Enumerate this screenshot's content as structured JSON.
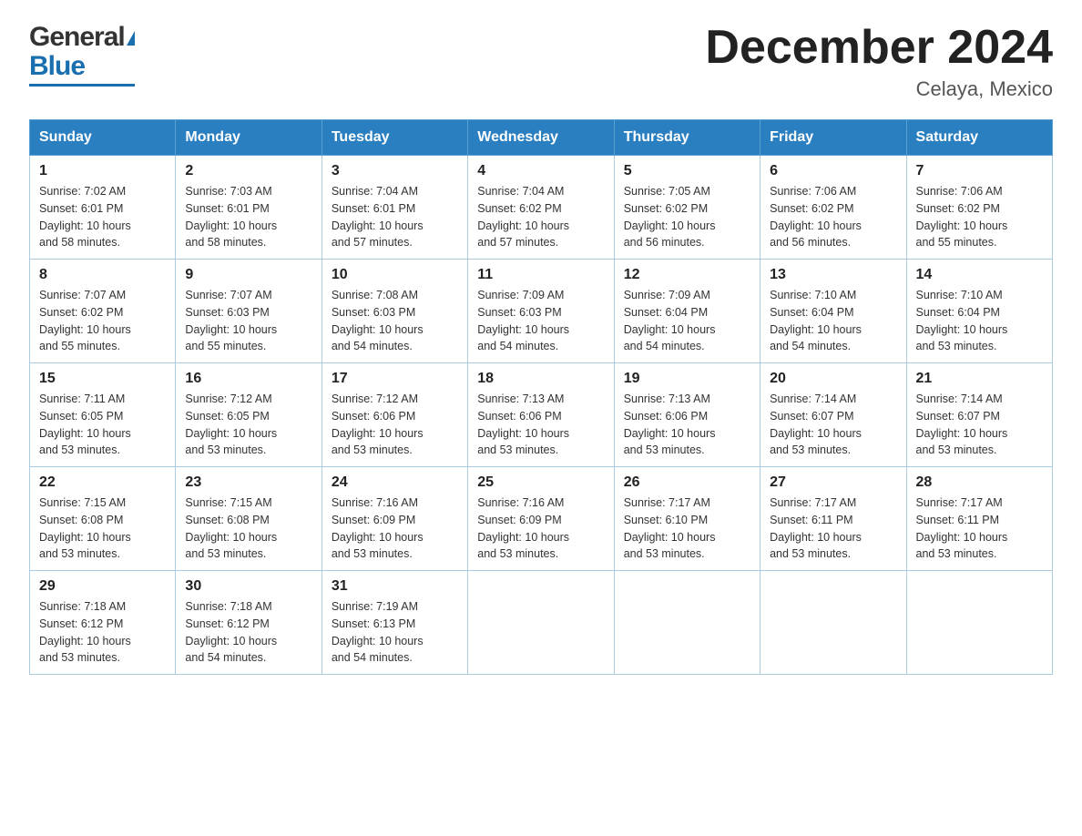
{
  "header": {
    "logo_general": "General",
    "logo_blue": "Blue",
    "month_title": "December 2024",
    "location": "Celaya, Mexico"
  },
  "weekdays": [
    "Sunday",
    "Monday",
    "Tuesday",
    "Wednesday",
    "Thursday",
    "Friday",
    "Saturday"
  ],
  "weeks": [
    [
      {
        "day": "1",
        "sunrise": "7:02 AM",
        "sunset": "6:01 PM",
        "daylight": "10 hours and 58 minutes."
      },
      {
        "day": "2",
        "sunrise": "7:03 AM",
        "sunset": "6:01 PM",
        "daylight": "10 hours and 58 minutes."
      },
      {
        "day": "3",
        "sunrise": "7:04 AM",
        "sunset": "6:01 PM",
        "daylight": "10 hours and 57 minutes."
      },
      {
        "day": "4",
        "sunrise": "7:04 AM",
        "sunset": "6:02 PM",
        "daylight": "10 hours and 57 minutes."
      },
      {
        "day": "5",
        "sunrise": "7:05 AM",
        "sunset": "6:02 PM",
        "daylight": "10 hours and 56 minutes."
      },
      {
        "day": "6",
        "sunrise": "7:06 AM",
        "sunset": "6:02 PM",
        "daylight": "10 hours and 56 minutes."
      },
      {
        "day": "7",
        "sunrise": "7:06 AM",
        "sunset": "6:02 PM",
        "daylight": "10 hours and 55 minutes."
      }
    ],
    [
      {
        "day": "8",
        "sunrise": "7:07 AM",
        "sunset": "6:02 PM",
        "daylight": "10 hours and 55 minutes."
      },
      {
        "day": "9",
        "sunrise": "7:07 AM",
        "sunset": "6:03 PM",
        "daylight": "10 hours and 55 minutes."
      },
      {
        "day": "10",
        "sunrise": "7:08 AM",
        "sunset": "6:03 PM",
        "daylight": "10 hours and 54 minutes."
      },
      {
        "day": "11",
        "sunrise": "7:09 AM",
        "sunset": "6:03 PM",
        "daylight": "10 hours and 54 minutes."
      },
      {
        "day": "12",
        "sunrise": "7:09 AM",
        "sunset": "6:04 PM",
        "daylight": "10 hours and 54 minutes."
      },
      {
        "day": "13",
        "sunrise": "7:10 AM",
        "sunset": "6:04 PM",
        "daylight": "10 hours and 54 minutes."
      },
      {
        "day": "14",
        "sunrise": "7:10 AM",
        "sunset": "6:04 PM",
        "daylight": "10 hours and 53 minutes."
      }
    ],
    [
      {
        "day": "15",
        "sunrise": "7:11 AM",
        "sunset": "6:05 PM",
        "daylight": "10 hours and 53 minutes."
      },
      {
        "day": "16",
        "sunrise": "7:12 AM",
        "sunset": "6:05 PM",
        "daylight": "10 hours and 53 minutes."
      },
      {
        "day": "17",
        "sunrise": "7:12 AM",
        "sunset": "6:06 PM",
        "daylight": "10 hours and 53 minutes."
      },
      {
        "day": "18",
        "sunrise": "7:13 AM",
        "sunset": "6:06 PM",
        "daylight": "10 hours and 53 minutes."
      },
      {
        "day": "19",
        "sunrise": "7:13 AM",
        "sunset": "6:06 PM",
        "daylight": "10 hours and 53 minutes."
      },
      {
        "day": "20",
        "sunrise": "7:14 AM",
        "sunset": "6:07 PM",
        "daylight": "10 hours and 53 minutes."
      },
      {
        "day": "21",
        "sunrise": "7:14 AM",
        "sunset": "6:07 PM",
        "daylight": "10 hours and 53 minutes."
      }
    ],
    [
      {
        "day": "22",
        "sunrise": "7:15 AM",
        "sunset": "6:08 PM",
        "daylight": "10 hours and 53 minutes."
      },
      {
        "day": "23",
        "sunrise": "7:15 AM",
        "sunset": "6:08 PM",
        "daylight": "10 hours and 53 minutes."
      },
      {
        "day": "24",
        "sunrise": "7:16 AM",
        "sunset": "6:09 PM",
        "daylight": "10 hours and 53 minutes."
      },
      {
        "day": "25",
        "sunrise": "7:16 AM",
        "sunset": "6:09 PM",
        "daylight": "10 hours and 53 minutes."
      },
      {
        "day": "26",
        "sunrise": "7:17 AM",
        "sunset": "6:10 PM",
        "daylight": "10 hours and 53 minutes."
      },
      {
        "day": "27",
        "sunrise": "7:17 AM",
        "sunset": "6:11 PM",
        "daylight": "10 hours and 53 minutes."
      },
      {
        "day": "28",
        "sunrise": "7:17 AM",
        "sunset": "6:11 PM",
        "daylight": "10 hours and 53 minutes."
      }
    ],
    [
      {
        "day": "29",
        "sunrise": "7:18 AM",
        "sunset": "6:12 PM",
        "daylight": "10 hours and 53 minutes."
      },
      {
        "day": "30",
        "sunrise": "7:18 AM",
        "sunset": "6:12 PM",
        "daylight": "10 hours and 54 minutes."
      },
      {
        "day": "31",
        "sunrise": "7:19 AM",
        "sunset": "6:13 PM",
        "daylight": "10 hours and 54 minutes."
      },
      null,
      null,
      null,
      null
    ]
  ],
  "labels": {
    "sunrise": "Sunrise:",
    "sunset": "Sunset:",
    "daylight": "Daylight:"
  }
}
